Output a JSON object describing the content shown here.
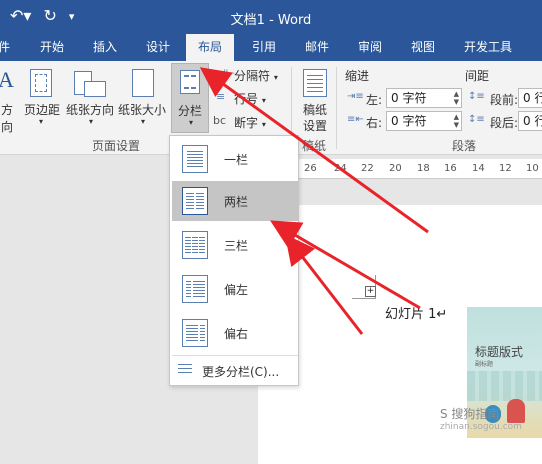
{
  "titlebar": {
    "undo_icon": "undo-icon",
    "redo_icon": "redo-icon",
    "customize_icon": "customize-icon",
    "title": "文档1 - Word"
  },
  "tabs": [
    "件",
    "开始",
    "插入",
    "设计",
    "布局",
    "引用",
    "邮件",
    "审阅",
    "视图",
    "开发工具"
  ],
  "active_tab": "布局",
  "page_setup": {
    "direction": "方向",
    "margins": "页边距",
    "orientation": "纸张方向",
    "size": "纸张大小",
    "columns": "分栏",
    "group_label": "页面设置"
  },
  "breaks": {
    "breaks_label": "分隔符",
    "line_numbers_label": "行号",
    "hyphenation_label": "断字"
  },
  "manuscript": {
    "label_top": "稿纸",
    "label_bottom": "设置",
    "group_label": "稿纸"
  },
  "paragraph": {
    "indent_header": "缩进",
    "spacing_header": "间距",
    "left_label": "左:",
    "right_label": "右:",
    "before_label": "段前:",
    "after_label": "段后:",
    "left_value": "0 字符",
    "right_value": "0 字符",
    "before_value": "0 行",
    "after_value": "0 行",
    "group_label": "段落"
  },
  "ruler": [
    "26",
    "24",
    "22",
    "20",
    "18",
    "16",
    "14",
    "12",
    "10"
  ],
  "columns_menu": {
    "items": [
      "一栏",
      "两栏",
      "三栏",
      "偏左",
      "偏右"
    ],
    "highlighted": "两栏",
    "more_label": "更多分栏(C)..."
  },
  "document": {
    "slide_label": "幻灯片 1↵",
    "slide_title": "标题版式",
    "slide_subtitle": "副标题"
  },
  "watermark": {
    "text": "S 搜狗指南",
    "url": "zhinan.sogou.com"
  },
  "colors": {
    "accent": "#2b579a",
    "arrow": "#e8232a",
    "highlight": "#c5c5c5"
  }
}
